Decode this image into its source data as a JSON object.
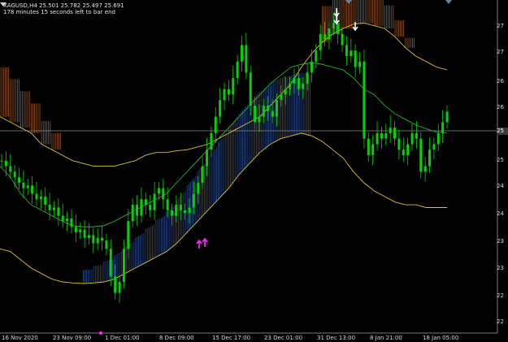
{
  "header": {
    "symbol_line": "XAGUSD,H4  25.501 25.782 25.497 25.691",
    "timer": "178 minutes 15 seconds left to bar end"
  },
  "price_axis": {
    "ticks": [
      "27",
      "27",
      "26",
      "26",
      "25",
      "24",
      "24",
      "23",
      "23",
      "22",
      "22"
    ],
    "current_price": "25"
  },
  "time_axis": {
    "labels": [
      "16 Nov 2020",
      "23 Nov 09:00",
      "1 Dec 01:00",
      "8 Dec 09:00",
      "15 Dec 17:00",
      "23 Dec 01:00",
      "31 Dec 13:00",
      "8 Jan 21:00",
      "18 Jan 05:00"
    ]
  },
  "colors": {
    "background": "#000000",
    "candle": "#00d400",
    "band": "#e0c030",
    "midline": "#2ec52e",
    "ribbon_bear": "#c8773d",
    "ribbon_bull": "#3f68b8",
    "arrow_sell": "#ffffff",
    "arrow_buy": "#ff2cff",
    "price_line": "#8a8a8a"
  },
  "chart_data": {
    "type": "candlestick",
    "instrument": "XAGUSD",
    "timeframe": "H4",
    "ohlc_last": {
      "open": 25.501,
      "high": 25.782,
      "low": 25.497,
      "close": 25.691
    },
    "ylim": [
      21.7,
      27.6
    ],
    "close_series": [
      24.8,
      24.7,
      24.6,
      24.5,
      24.4,
      24.3,
      24.35,
      24.2,
      24.1,
      24.15,
      24.0,
      23.9,
      23.95,
      23.8,
      23.7,
      23.75,
      23.6,
      23.5,
      23.55,
      23.4,
      23.45,
      23.3,
      23.4,
      23.35,
      23.2,
      22.7,
      22.4,
      22.6,
      23.2,
      23.7,
      24.0,
      23.8,
      24.1,
      24.0,
      23.9,
      24.2,
      24.3,
      24.1,
      23.9,
      23.8,
      24.0,
      23.9,
      23.85,
      23.95,
      24.2,
      24.4,
      24.7,
      25.0,
      25.3,
      25.6,
      25.9,
      26.1,
      26.0,
      26.3,
      26.6,
      26.9,
      26.4,
      25.8,
      25.5,
      25.6,
      25.8,
      25.7,
      25.6,
      25.9,
      26.0,
      26.1,
      26.2,
      26.3,
      26.1,
      26.2,
      26.4,
      26.6,
      26.8,
      27.1,
      27.0,
      27.2,
      27.3,
      27.1,
      26.9,
      26.7,
      26.8,
      26.5,
      26.6,
      25.2,
      24.9,
      25.1,
      25.3,
      25.2,
      25.3,
      25.4,
      25.2,
      25.0,
      24.9,
      25.1,
      25.3,
      25.2,
      24.6,
      24.7,
      25.0,
      25.1,
      25.3,
      25.5,
      25.691
    ],
    "upper_band": [
      25.6,
      25.5,
      25.4,
      25.3,
      25.1,
      25.0,
      24.9,
      24.8,
      24.75,
      24.7,
      24.7,
      24.7,
      24.75,
      24.8,
      24.9,
      24.95,
      24.95,
      24.98,
      25.0,
      25.05,
      25.1,
      25.2,
      25.3,
      25.4,
      25.5,
      25.6,
      25.8,
      26.0,
      26.2,
      26.5,
      26.75,
      26.95,
      27.1,
      27.2,
      27.28,
      27.3,
      27.25,
      27.2,
      27.05,
      26.85,
      26.7,
      26.6,
      26.5,
      26.45
    ],
    "mid_line": [
      24.7,
      24.5,
      24.2,
      24.0,
      23.9,
      23.8,
      23.7,
      23.62,
      23.6,
      23.6,
      23.62,
      23.7,
      23.8,
      23.9,
      24.0,
      24.1,
      24.2,
      24.4,
      24.6,
      24.8,
      25.0,
      25.2,
      25.4,
      25.6,
      25.8,
      26.0,
      26.2,
      26.35,
      26.5,
      26.55,
      26.58,
      26.55,
      26.5,
      26.45,
      26.3,
      26.1,
      26.0,
      25.8,
      25.65,
      25.55,
      25.45,
      25.38,
      25.32,
      25.3
    ],
    "lower_band": [
      23.2,
      23.15,
      23.0,
      22.85,
      22.75,
      22.65,
      22.6,
      22.58,
      22.57,
      22.58,
      22.6,
      22.65,
      22.75,
      22.85,
      22.95,
      23.05,
      23.15,
      23.3,
      23.5,
      23.7,
      23.9,
      24.1,
      24.3,
      24.55,
      24.75,
      24.95,
      25.1,
      25.2,
      25.25,
      25.3,
      25.25,
      25.15,
      25.0,
      24.85,
      24.6,
      24.4,
      24.25,
      24.15,
      24.05,
      24.0,
      24.0,
      23.95,
      23.95,
      23.95
    ],
    "signals": [
      {
        "type": "sell",
        "count": 2
      },
      {
        "type": "sell",
        "count": 1
      },
      {
        "type": "buy",
        "count": 2
      }
    ]
  }
}
